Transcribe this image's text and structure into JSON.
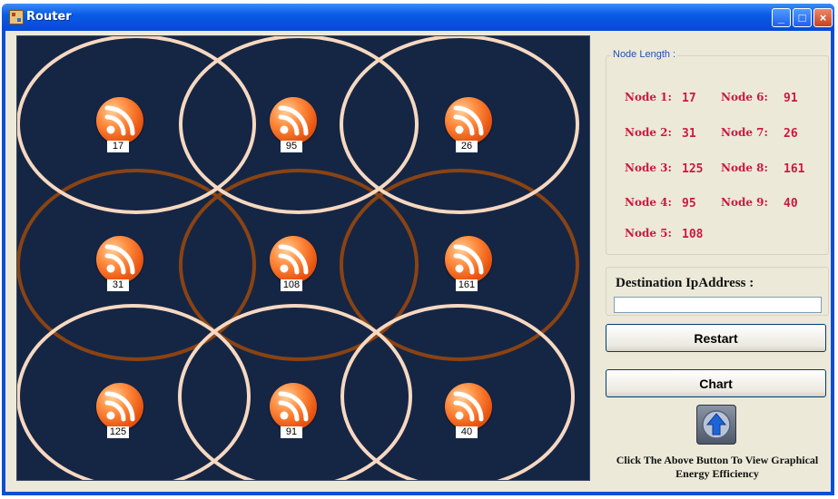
{
  "window": {
    "title": "Router",
    "minimize": "_",
    "maximize": "□",
    "close": "×"
  },
  "colors": {
    "canvas_bg": "#152645",
    "ring_light": "#f7d8c0",
    "ring_brown": "#8a4312",
    "node_text_red": "#cc1844"
  },
  "canvas": {
    "nodes": [
      {
        "label": "17",
        "icon": "rss-icon"
      },
      {
        "label": "95",
        "icon": "rss-icon"
      },
      {
        "label": "26",
        "icon": "rss-icon"
      },
      {
        "label": "31",
        "icon": "rss-icon"
      },
      {
        "label": "108",
        "icon": "rss-icon"
      },
      {
        "label": "161",
        "icon": "rss-icon"
      },
      {
        "label": "125",
        "icon": "rss-icon"
      },
      {
        "label": "91",
        "icon": "rss-icon"
      },
      {
        "label": "40",
        "icon": "rss-icon"
      }
    ]
  },
  "node_length": {
    "title": "Node Length :",
    "items": [
      {
        "label": "Node 1:",
        "value": "17"
      },
      {
        "label": "Node 2:",
        "value": "31"
      },
      {
        "label": "Node 3:",
        "value": "125"
      },
      {
        "label": "Node 4:",
        "value": "95"
      },
      {
        "label": "Node 5:",
        "value": "108"
      },
      {
        "label": "Node 6:",
        "value": "91"
      },
      {
        "label": "Node 7:",
        "value": "26"
      },
      {
        "label": "Node 8:",
        "value": "161"
      },
      {
        "label": "Node 9:",
        "value": "40"
      }
    ]
  },
  "destination": {
    "label": "Destination IpAddress :",
    "value": ""
  },
  "buttons": {
    "restart": "Restart",
    "chart": "Chart",
    "graph_icon": "up-arrow-icon"
  },
  "hint": "Click The Above Button To View Graphical Energy Efficiency"
}
